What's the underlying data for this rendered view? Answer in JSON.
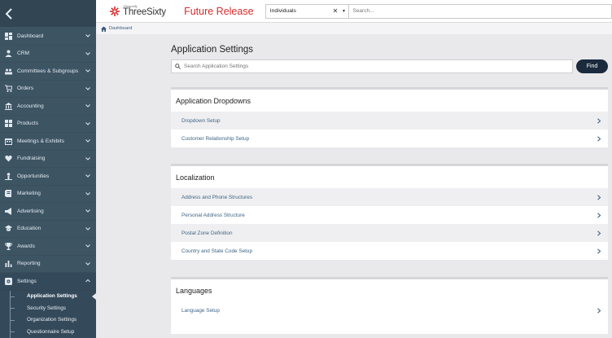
{
  "sidebar": {
    "items": [
      {
        "label": "Dashboard",
        "icon": "dashboard-icon"
      },
      {
        "label": "CRM",
        "icon": "person-icon"
      },
      {
        "label": "Committees & Subgroups",
        "icon": "group-icon"
      },
      {
        "label": "Orders",
        "icon": "cart-icon"
      },
      {
        "label": "Accounting",
        "icon": "bank-icon"
      },
      {
        "label": "Products",
        "icon": "grid-icon"
      },
      {
        "label": "Meetings & Exhibits",
        "icon": "calendar-icon"
      },
      {
        "label": "Fundraising",
        "icon": "heart-icon"
      },
      {
        "label": "Opportunities",
        "icon": "person-up-icon"
      },
      {
        "label": "Marketing",
        "icon": "marketing-icon"
      },
      {
        "label": "Advertising",
        "icon": "megaphone-icon"
      },
      {
        "label": "Education",
        "icon": "graduation-icon"
      },
      {
        "label": "Awards",
        "icon": "trophy-icon"
      },
      {
        "label": "Reporting",
        "icon": "bar-chart-icon"
      },
      {
        "label": "Settings",
        "icon": "settings-icon"
      }
    ],
    "sub_items": [
      "Application Settings",
      "Security Settings",
      "Organization Settings",
      "Questionnaire Setup"
    ]
  },
  "header": {
    "logo_small": "Personify",
    "logo_big": "ThreeSixty",
    "release": "Future Release",
    "entity_value": "Individuals",
    "search_placeholder": "Search..."
  },
  "breadcrumb": {
    "label": "Dashboard"
  },
  "main": {
    "title": "Application Settings",
    "search_placeholder": "Search Application Settings",
    "find_label": "Find",
    "sections": [
      {
        "title": "Application Dropdowns",
        "rows": [
          "Dropdown Setup",
          "Customer Relationship Setup"
        ]
      },
      {
        "title": "Localization",
        "rows": [
          "Address and Phone Structures",
          "Personal Address Structure",
          "Postal Zone Definition",
          "Country and State Code Setup"
        ]
      },
      {
        "title": "Languages",
        "rows": [
          "Language Setup"
        ]
      }
    ]
  },
  "colors": {
    "sidebar_bg": "#3d5463",
    "release_red": "#d62b2b",
    "find_button": "#1b2b3d",
    "link_blue": "#3f6585"
  }
}
